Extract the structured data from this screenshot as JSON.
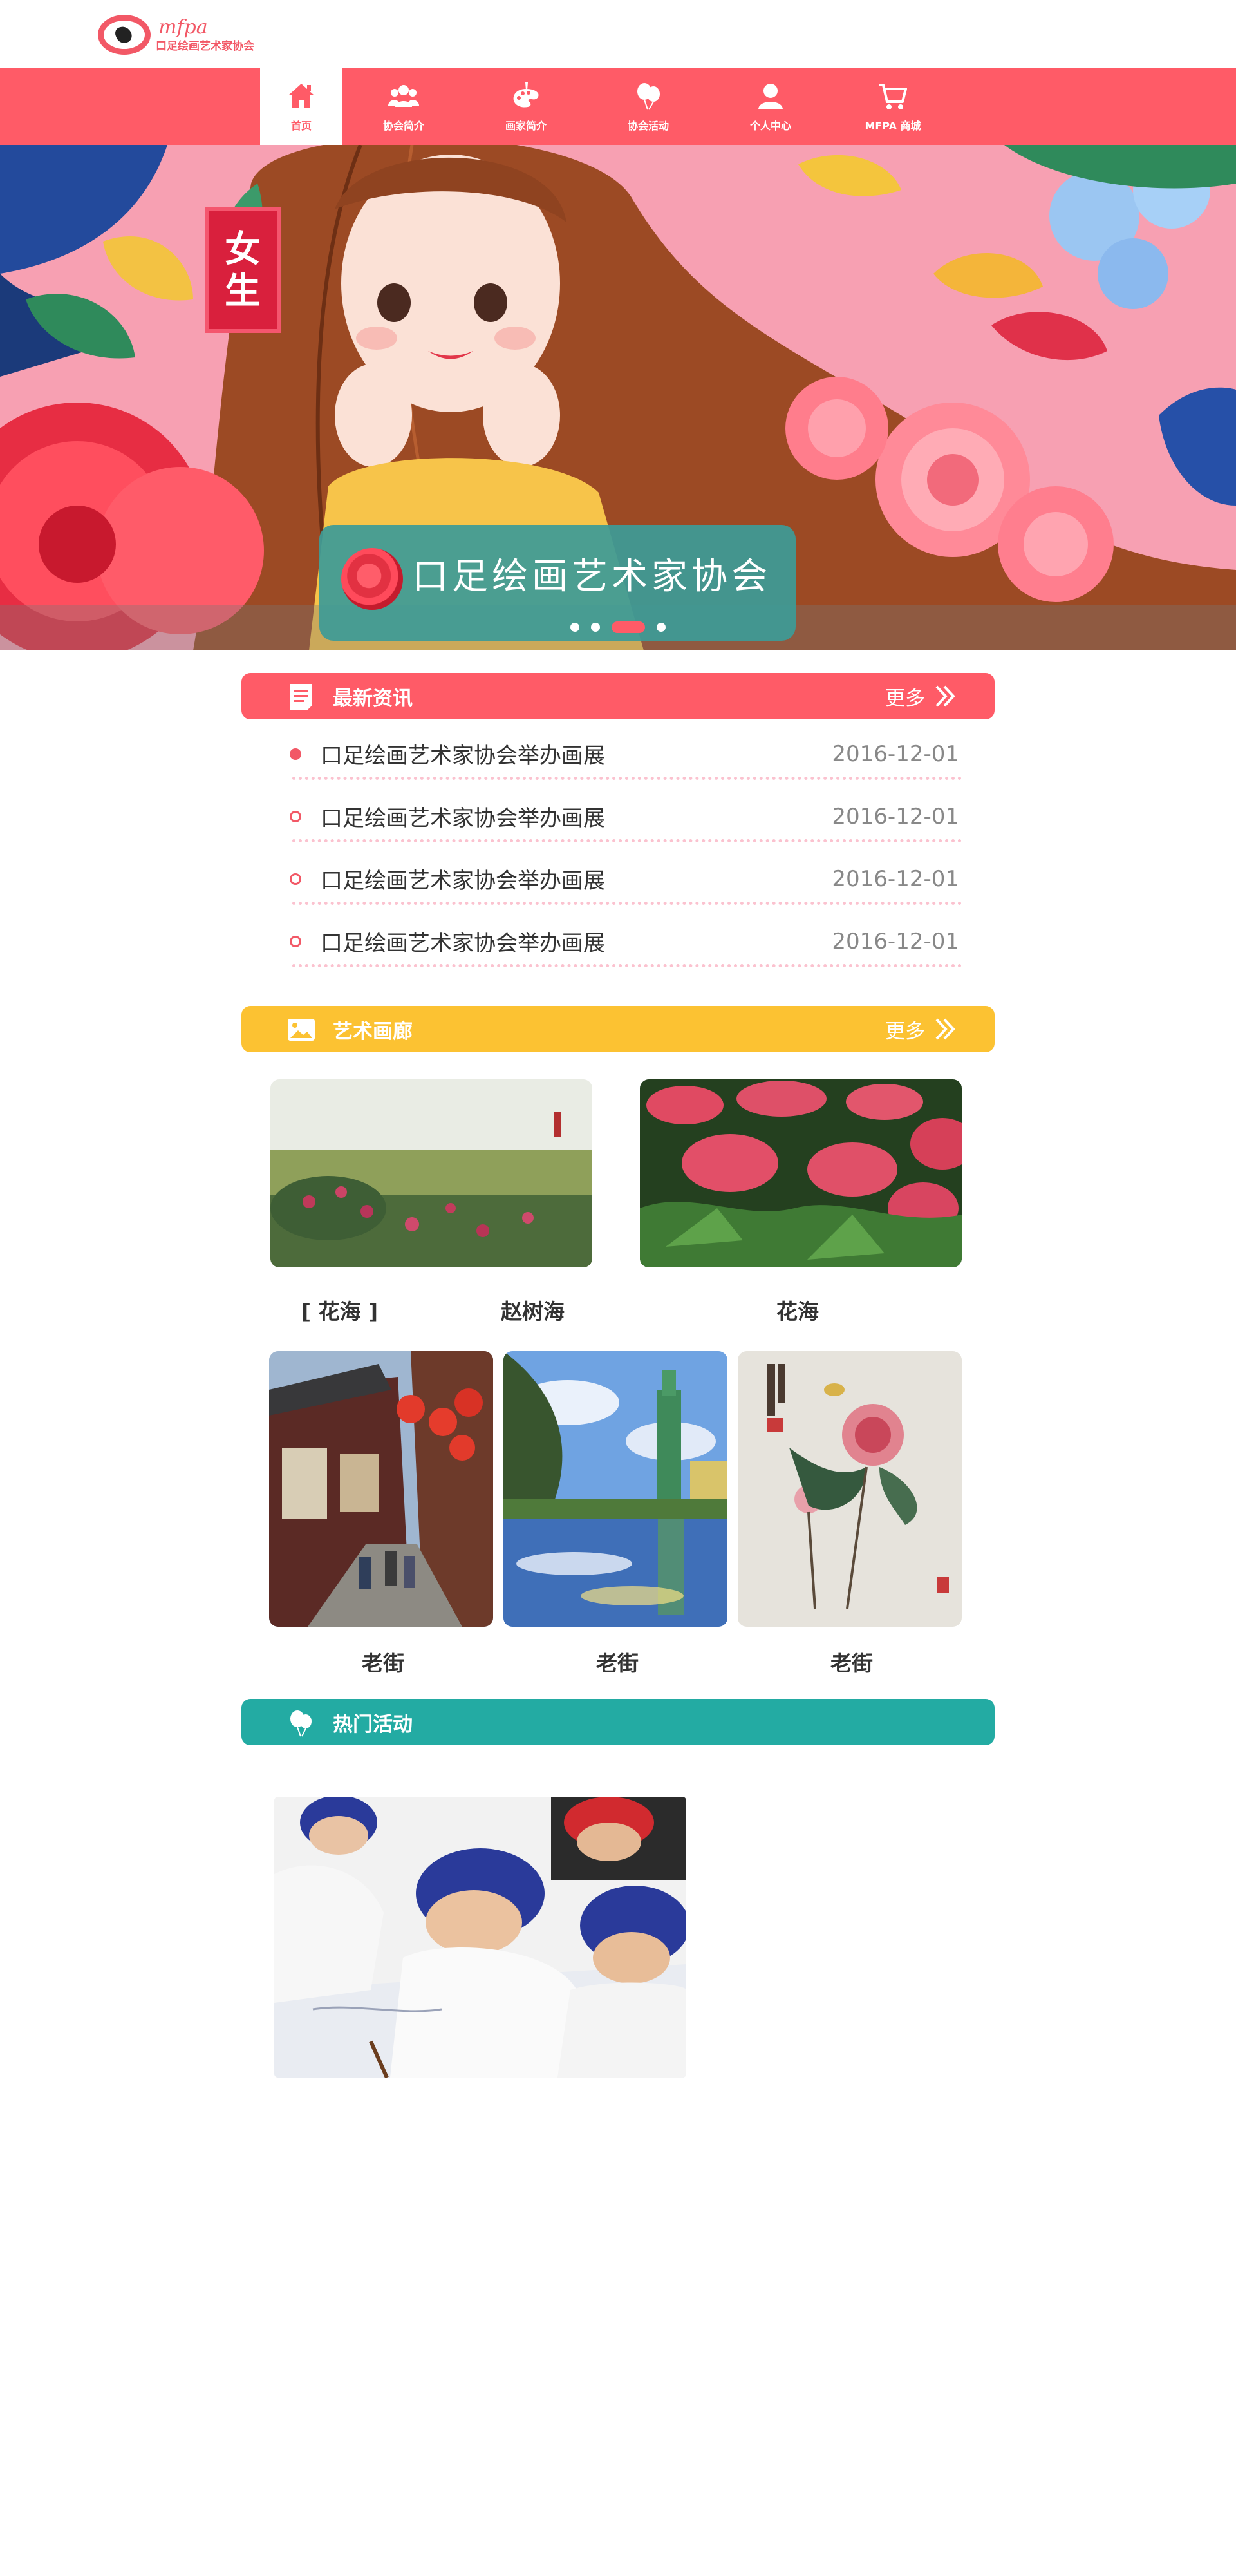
{
  "site": {
    "logo_en": "mfpa",
    "logo_cn": "口足绘画艺术家协会"
  },
  "nav": {
    "items": [
      {
        "label": "首页",
        "icon": "home-icon",
        "active": true
      },
      {
        "label": "协会简介",
        "icon": "people-icon",
        "active": false
      },
      {
        "label": "画家简介",
        "icon": "palette-icon",
        "active": false
      },
      {
        "label": "协会活动",
        "icon": "balloon-icon",
        "active": false
      },
      {
        "label": "个人中心",
        "icon": "user-icon",
        "active": false
      },
      {
        "label": "MFPA 商城",
        "icon": "cart-icon",
        "active": false
      }
    ]
  },
  "banner": {
    "badge_line1": "女",
    "badge_line2": "生",
    "title": "口足绘画艺术家协会",
    "slide_count": 4,
    "active_slide": 3
  },
  "news": {
    "title": "最新资讯",
    "more": "更多",
    "items": [
      {
        "title": "口足绘画艺术家协会举办画展",
        "date": "2016-12-01"
      },
      {
        "title": "口足绘画艺术家协会举办画展",
        "date": "2016-12-01"
      },
      {
        "title": "口足绘画艺术家协会举办画展",
        "date": "2016-12-01"
      },
      {
        "title": "口足绘画艺术家协会举办画展",
        "date": "2016-12-01"
      }
    ]
  },
  "gallery": {
    "title": "艺术画廊",
    "more": "更多",
    "row1": {
      "caption_bracket": "[ 花海 ]",
      "caption_artist": "赵树海",
      "caption_right": "花海"
    },
    "row2": [
      "老街",
      "老街",
      "老街"
    ]
  },
  "activities": {
    "title": "热门活动"
  },
  "colors": {
    "primary": "#ff5b67",
    "gallery": "#fcc232",
    "activities": "#23aba3"
  }
}
